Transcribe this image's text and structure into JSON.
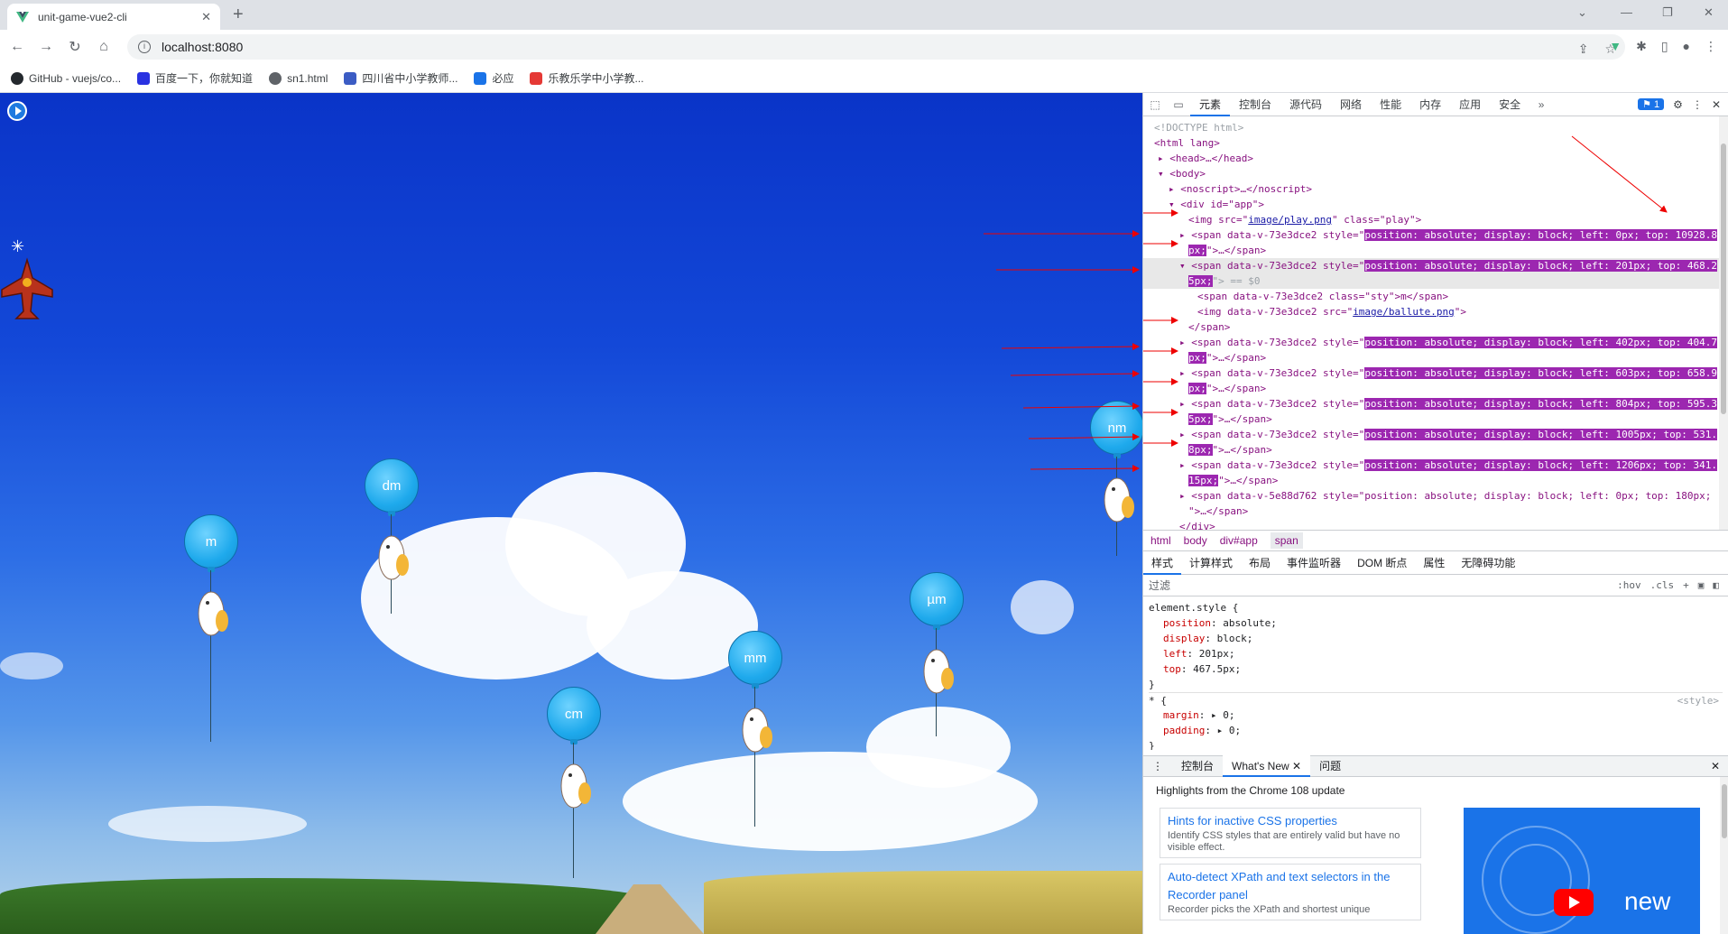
{
  "browser": {
    "tab_title": "unit-game-vue2-cli",
    "url": "localhost:8080",
    "bookmarks": [
      {
        "label": "GitHub - vuejs/co...",
        "color": "#24292e"
      },
      {
        "label": "百度一下，你就知道",
        "color": "#2932e1"
      },
      {
        "label": "sn1.html",
        "color": "#5f6368"
      },
      {
        "label": "四川省中小学教师...",
        "color": "#3b5cc4"
      },
      {
        "label": "必应",
        "color": "#1a73e8"
      },
      {
        "label": "乐教乐学中小学教...",
        "color": "#e53935"
      }
    ]
  },
  "game": {
    "balloons": [
      {
        "label": "m"
      },
      {
        "label": "dm"
      },
      {
        "label": "cm"
      },
      {
        "label": "mm"
      },
      {
        "label": "µm"
      },
      {
        "label": "nm"
      }
    ]
  },
  "devtools": {
    "tabs": [
      "元素",
      "控制台",
      "源代码",
      "网络",
      "性能",
      "内存",
      "应用",
      "安全"
    ],
    "issues_badge": "1",
    "dom": {
      "doctype": "<!DOCTYPE html>",
      "html_open": "<html lang>",
      "head": "<head>…</head>",
      "body_open": "<body>",
      "noscript": "<noscript>…</noscript>",
      "div_app": "<div id=\"app\">",
      "img_play_pre": "<img src=\"",
      "img_play_src": "image/play.png",
      "img_play_post": "\" class=\"play\">",
      "span_prefix": "<span data-v-73e3dce2 style=\"",
      "spans": [
        {
          "style_a": "position: absolute; display: block; left: 0px; top: 10928.8",
          "style_b": "px;",
          "tail": "\">…</span>"
        },
        {
          "style_a": "position: absolute; display: block; left: 201px; top: 468.2",
          "style_b": "5px;",
          "tail": "\"> == $0"
        },
        {
          "style_a": "position: absolute; display: block; left: 402px; top: 404.7",
          "style_b": "px;",
          "tail": "\">…</span>"
        },
        {
          "style_a": "position: absolute; display: block; left: 603px; top: 658.9",
          "style_b": "px;",
          "tail": "\">…</span>"
        },
        {
          "style_a": "position: absolute; display: block; left: 804px; top: 595.3",
          "style_b": "5px;",
          "tail": "\">…</span>"
        },
        {
          "style_a": "position: absolute; display: block; left: 1005px; top: 531.",
          "style_b": "8px;",
          "tail": "\">…</span>"
        },
        {
          "style_a": "position: absolute; display: block; left: 1206px; top: 341.",
          "style_b": "15px;",
          "tail": "\">…</span>"
        }
      ],
      "inner_span": "<span data-v-73e3dce2 class=\"sty\">m</span>",
      "inner_img_pre": "<img data-v-73e3dce2 src=\"",
      "inner_img_src": "image/ballute.png",
      "inner_img_post": "\">",
      "close_span": "</span>",
      "last_span": "<span data-v-5e88d762 style=\"position: absolute; display: block; left: 0px; top: 180px;",
      "last_span_tail": "\">…</span>",
      "close_div": "</div>"
    },
    "breadcrumb": [
      "html",
      "body",
      "div#app",
      "span"
    ],
    "subtabs": [
      "样式",
      "计算样式",
      "布局",
      "事件监听器",
      "DOM 断点",
      "属性",
      "无障碍功能"
    ],
    "filter_placeholder": "过滤",
    "filter_tools": [
      ":hov",
      ".cls",
      "+"
    ],
    "styles": {
      "element_selector": "element.style {",
      "props": [
        {
          "name": "position",
          "value": "absolute;"
        },
        {
          "name": "display",
          "value": "block;"
        },
        {
          "name": "left",
          "value": "201px;"
        },
        {
          "name": "top",
          "value": "467.5px;"
        }
      ],
      "close": "}",
      "universal_selector": "* {",
      "universal_source": "<style>",
      "universal_props": [
        {
          "name": "margin",
          "value": "▸ 0;"
        },
        {
          "name": "padding",
          "value": "▸ 0;"
        }
      ]
    },
    "drawer": {
      "tabs": [
        "控制台",
        "What's New",
        "问题"
      ],
      "subtitle": "Highlights from the Chrome 108 update",
      "cards": [
        {
          "title": "Hints for inactive CSS properties",
          "desc": "Identify CSS styles that are entirely valid but have no visible effect."
        },
        {
          "title": "Auto-detect XPath and text selectors in the Recorder panel",
          "desc": "Recorder picks the XPath and shortest unique"
        }
      ],
      "video_label": "new"
    }
  }
}
